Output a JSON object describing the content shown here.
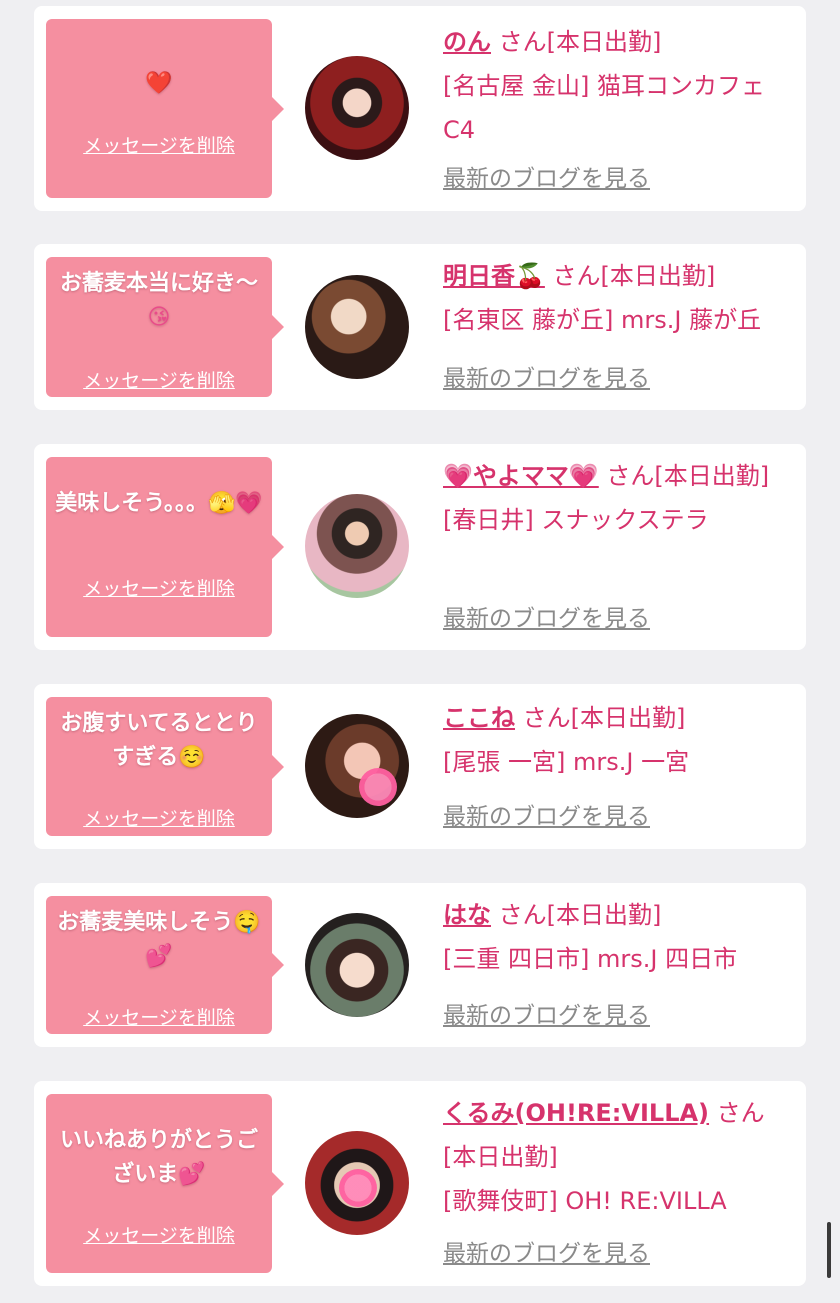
{
  "items": [
    {
      "message": "",
      "emoji": "❤️",
      "delete_label": "メッセージを削除",
      "name": "のん",
      "san_status": "さん[本日出勤]",
      "area": "[名古屋 金山] 猫耳コンカフェ C4",
      "blog_label": "最新のブログを見る"
    },
    {
      "message": "お蕎麦本当に好き〜",
      "emoji": "😘",
      "delete_label": "メッセージを削除",
      "name": "明日香🍒",
      "san_status": "さん[本日出勤]",
      "area": "[名東区 藤が丘] mrs.J 藤が丘",
      "blog_label": "最新のブログを見る"
    },
    {
      "message": "美味しそう。。。",
      "emoji": "🫣💗",
      "delete_label": "メッセージを削除",
      "name": "💗やよママ💗",
      "san_status": "さん[本日出勤]",
      "area": "[春日井] スナックステラ",
      "blog_label": "最新のブログを見る"
    },
    {
      "message": "お腹すいてるととりすぎる",
      "emoji": "☺️",
      "delete_label": "メッセージを削除",
      "name": "ここね",
      "san_status": "さん[本日出勤]",
      "area": "[尾張 一宮] mrs.J 一宮",
      "blog_label": "最新のブログを見る"
    },
    {
      "message": "お蕎麦美味しそう",
      "emoji": "🤤💕",
      "delete_label": "メッセージを削除",
      "name": "はな",
      "san_status": "さん[本日出勤]",
      "area": "[三重 四日市] mrs.J 四日市",
      "blog_label": "最新のブログを見る"
    },
    {
      "message": "いいねありがとうございま",
      "emoji": "💕",
      "delete_label": "メッセージを削除",
      "name": "くるみ(OH!RE:VILLA)",
      "san_status": "さん[本日出勤]",
      "area": "[歌舞伎町] OH! RE:VILLA",
      "blog_label": "最新のブログを見る"
    }
  ],
  "colors": {
    "bubble": "#f58fa0",
    "accent_text": "#d6336c",
    "link_gray": "#8a8a8a",
    "background": "#efeff2"
  }
}
